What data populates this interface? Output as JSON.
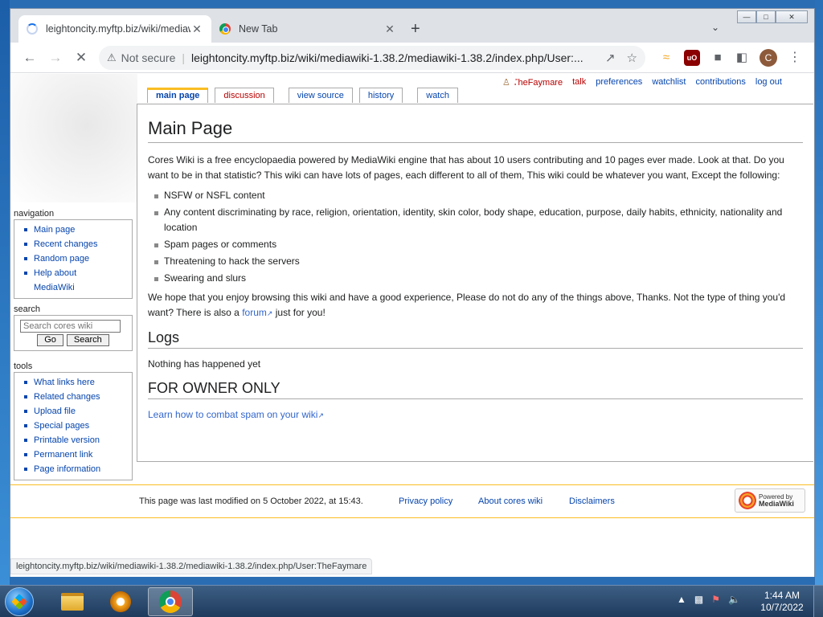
{
  "browser": {
    "tabs": [
      {
        "title": "leightoncity.myftp.biz/wiki/mediawiki",
        "close": "✕"
      },
      {
        "title": "New Tab",
        "close": "✕"
      }
    ],
    "new_tab_glyph": "+",
    "url_security": "Not secure",
    "url": "leightoncity.myftp.biz/wiki/mediawiki-1.38.2/mediawiki-1.38.2/index.php/User:...",
    "profile_initial": "C",
    "status_url": "leightoncity.myftp.biz/wiki/mediawiki-1.38.2/mediawiki-1.38.2/index.php/User:TheFaymare"
  },
  "personal": {
    "username": "TheFaymare",
    "talk": "talk",
    "preferences": "preferences",
    "watchlist": "watchlist",
    "contributions": "contributions",
    "logout": "log out"
  },
  "page_tabs": {
    "main": "main page",
    "discussion": "discussion",
    "view_source": "view source",
    "history": "history",
    "watch": "watch"
  },
  "article": {
    "title": "Main Page",
    "intro": "Cores Wiki is a free encyclopaedia powered by MediaWiki engine that has about 10 users contributing and 10 pages ever made. Look at that. Do you want to be in that statistic? This wiki can have lots of pages, each different to all of them, This wiki could be whatever you want, Except the following:",
    "rules": [
      "NSFW or NSFL content",
      "Any content discriminating by race, religion, orientation, identity, skin color, body shape, education, purpose, daily habits, ethnicity, nationality and location",
      "Spam pages or comments",
      "Threatening to hack the servers",
      "Swearing and slurs"
    ],
    "closing_before": "We hope that you enjoy browsing this wiki and have a good experience, Please do not do any of the things above, Thanks. Not the type of thing you'd want? There is also a ",
    "forum_link": "forum",
    "closing_after": " just for you!",
    "logs_heading": "Logs",
    "logs_text": "Nothing has happened yet",
    "owner_heading": "FOR OWNER ONLY",
    "spam_link": "Learn how to combat spam on your wiki"
  },
  "sidebar": {
    "navigation": {
      "heading": "navigation",
      "items": [
        "Main page",
        "Recent changes",
        "Random page",
        "Help about MediaWiki"
      ]
    },
    "search": {
      "heading": "search",
      "placeholder": "Search cores wiki",
      "go": "Go",
      "search": "Search"
    },
    "tools": {
      "heading": "tools",
      "items": [
        "What links here",
        "Related changes",
        "Upload file",
        "Special pages",
        "Printable version",
        "Permanent link",
        "Page information"
      ]
    }
  },
  "footer": {
    "last_modified": "This page was last modified on 5 October 2022, at 15:43.",
    "privacy": "Privacy policy",
    "about": "About cores wiki",
    "disclaimers": "Disclaimers",
    "powered_line1": "Powered by",
    "powered_line2": "MediaWiki"
  },
  "taskbar": {
    "time": "1:44 AM",
    "date": "10/7/2022"
  }
}
